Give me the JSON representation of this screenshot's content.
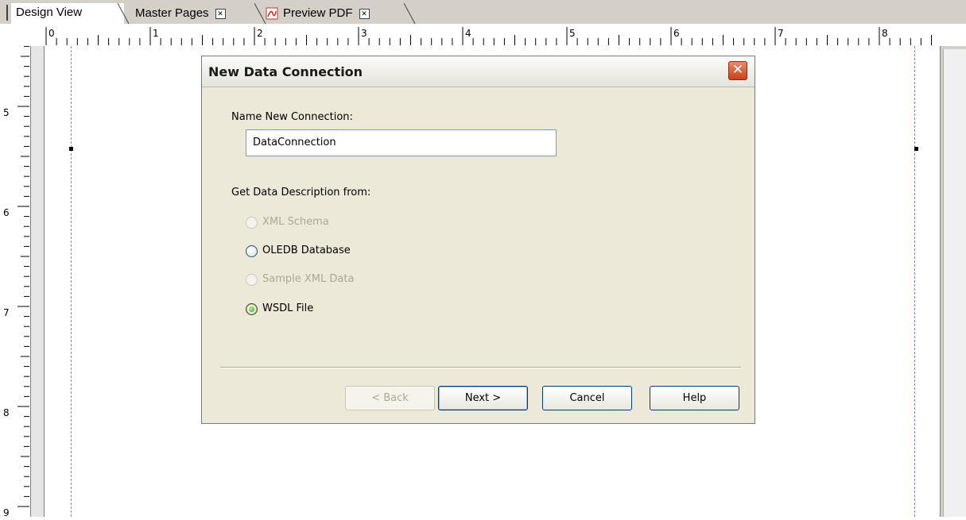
{
  "tabs": [
    {
      "label": "Design View",
      "active": true
    },
    {
      "label": "Master Pages",
      "active": false,
      "closable": true
    },
    {
      "label": "Preview PDF",
      "active": false,
      "closable": true,
      "icon": "pdf-icon"
    }
  ],
  "ruler": {
    "horizontal_labels": [
      "0",
      "1",
      "2",
      "3",
      "4",
      "5",
      "6",
      "7",
      "8"
    ],
    "vertical_labels": [
      "5",
      "6",
      "7",
      "8",
      "9"
    ]
  },
  "dialog": {
    "title": "New Data Connection",
    "close_glyph": "✕",
    "name_label": "Name New Connection:",
    "name_value": "DataConnection",
    "source_label": "Get Data Description from:",
    "options": [
      {
        "label": "XML Schema",
        "enabled": false,
        "checked": false
      },
      {
        "label": "OLEDB Database",
        "enabled": true,
        "checked": false
      },
      {
        "label": "Sample XML Data",
        "enabled": false,
        "checked": false
      },
      {
        "label": "WSDL File",
        "enabled": true,
        "checked": true
      }
    ],
    "buttons": {
      "back": "< Back",
      "next": "Next >",
      "cancel": "Cancel",
      "help": "Help"
    }
  },
  "colors": {
    "dialog_bg": "#ece9d8",
    "close_button": "#c8421c",
    "radio_checked_dot": "#21a121"
  }
}
